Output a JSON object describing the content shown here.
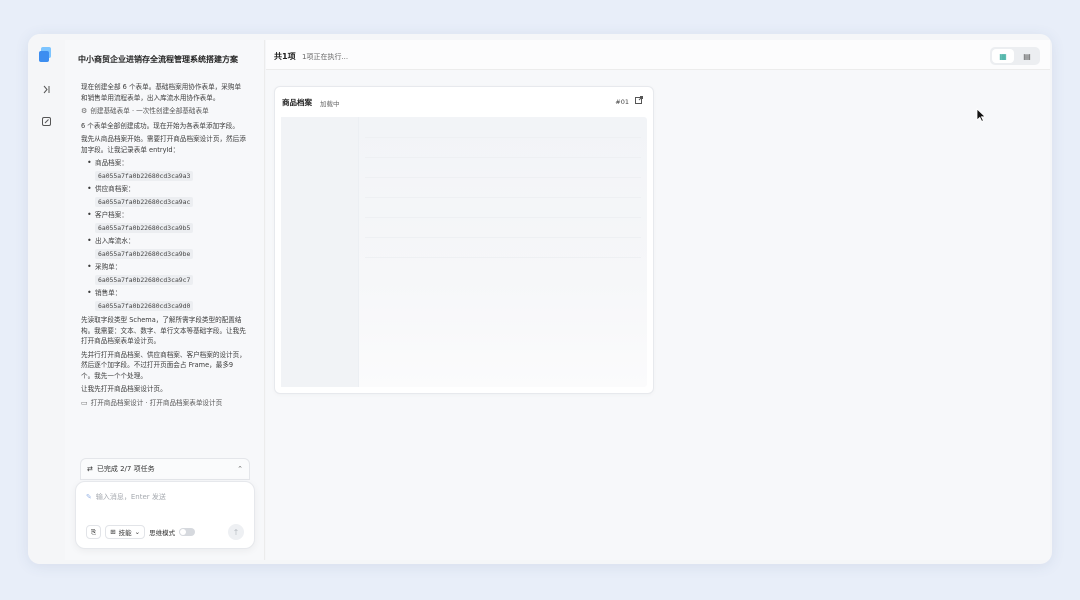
{
  "chat": {
    "title": "中小商贸企业进销存全流程管理系统搭建方案",
    "paragraph1": "现在创建全部 6 个表单。基础档案用协作表单，采购单和销售单用流程表单，出入库流水用协作表单。",
    "tool1": "创建基础表单 · 一次性创建全部基础表单",
    "paragraph2": "6 个表单全部创建成功。现在开始为各表单添加字段。",
    "paragraph3": "我先从商品档案开始。需要打开商品档案设计页，然后添加字段。让我记录表单 entryId：",
    "forms": [
      {
        "name": "商品档案：",
        "id": "6a055a7fa0b22680cd3ca9a3"
      },
      {
        "name": "供应商档案：",
        "id": "6a055a7fa0b22680cd3ca9ac"
      },
      {
        "name": "客户档案：",
        "id": "6a055a7fa0b22680cd3ca9b5"
      },
      {
        "name": "出入库流水：",
        "id": "6a055a7fa0b22680cd3ca9be"
      },
      {
        "name": "采购单：",
        "id": "6a055a7fa0b22680cd3ca9c7"
      },
      {
        "name": "销售单：",
        "id": "6a055a7fa0b22680cd3ca9d0"
      }
    ],
    "paragraph4": "先读取字段类型 Schema，了解所需字段类型的配置结构。我需要：文本、数字、单行文本等基础字段。让我先打开商品档案表单设计页。",
    "paragraph5": "先并行打开商品档案、供应商档案、客户档案的设计页，然后逐个加字段。不过打开页面会占 Frame，最多9个。我先一个个处理。",
    "paragraph6": "让我先打开商品档案设计页。",
    "tool2": "打开商品档案设计 · 打开商品档案表单设计页",
    "task_summary": "已完成 2/7 项任务",
    "input_placeholder": "输入消息，Enter 发送",
    "template_label": "技能",
    "mode_label": "思维模式"
  },
  "main": {
    "count_title": "共1项",
    "running_status": "1项正在执行...",
    "card": {
      "title": "商品档案",
      "status": "加载中",
      "index": "#01"
    }
  },
  "colors": {
    "accent": "#1a9f8f",
    "background": "#e8eef9",
    "logo": "#3d8ef0"
  },
  "icons": {
    "logo": "app-logo-icon",
    "collapse": "collapse-sidebar-icon",
    "new_chat": "edit-icon",
    "tool": "tool-icon",
    "tasks": "tasks-icon",
    "chevron": "chevron-up-icon",
    "attach": "paperclip-icon",
    "grid": "grid-icon",
    "send": "arrow-up-icon",
    "open": "external-link-icon",
    "view_grid": "grid-view-icon",
    "view_list": "list-view-icon"
  }
}
